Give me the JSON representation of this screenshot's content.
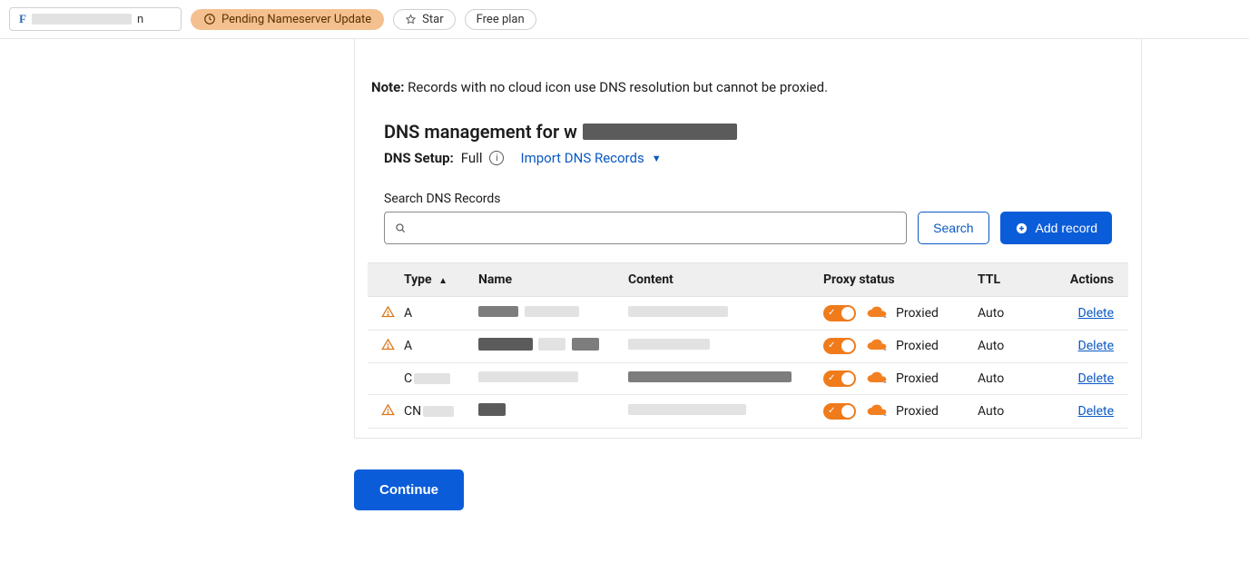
{
  "topbar": {
    "domain_glyph": "F",
    "domain_trailing": "n",
    "pending_label": "Pending Nameserver Update",
    "star_label": "Star",
    "plan_label": "Free plan"
  },
  "note": {
    "prefix": "Note:",
    "text": " Records with no cloud icon use DNS resolution but cannot be proxied."
  },
  "heading_prefix": "DNS management for w",
  "setup": {
    "label": "DNS Setup:",
    "value": "Full",
    "import_label": "Import DNS Records"
  },
  "search": {
    "label": "Search DNS Records",
    "placeholder": "",
    "search_button": "Search",
    "add_button": "Add record"
  },
  "columns": {
    "type": "Type",
    "name": "Name",
    "content": "Content",
    "proxy": "Proxy status",
    "ttl": "TTL",
    "actions": "Actions"
  },
  "rows": [
    {
      "warn": true,
      "type": "A",
      "proxy": "Proxied",
      "ttl": "Auto",
      "action": "Delete"
    },
    {
      "warn": true,
      "type": "A",
      "proxy": "Proxied",
      "ttl": "Auto",
      "action": "Delete"
    },
    {
      "warn": false,
      "type": "C",
      "proxy": "Proxied",
      "ttl": "Auto",
      "action": "Delete"
    },
    {
      "warn": true,
      "type": "CN",
      "proxy": "Proxied",
      "ttl": "Auto",
      "action": "Delete"
    }
  ],
  "continue_label": "Continue"
}
